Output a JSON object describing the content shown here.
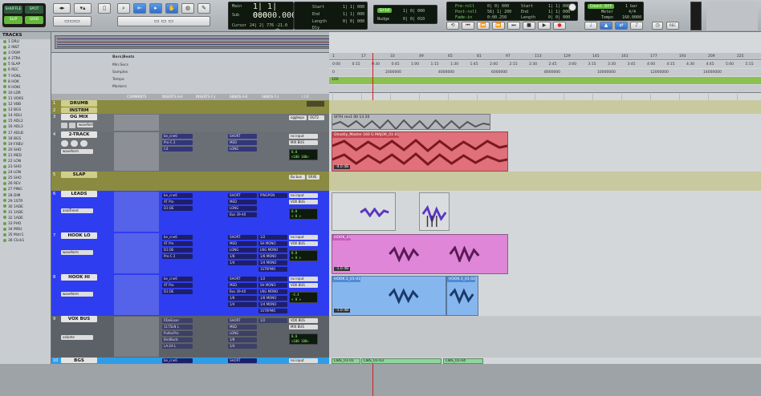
{
  "toolbar": {
    "modes": [
      "SHUFFLE",
      "SPOT",
      "SLIP",
      "GRID"
    ],
    "counter": {
      "main_label": "Main",
      "main_value": "1| 1| 000",
      "sub_label": "Sub",
      "sub_value": "0:000.000",
      "cursor_label": "Cursor",
      "cursor_value": "24| 2| 776",
      "db_value": "-21.0 db",
      "dly_label": "Dly"
    },
    "selection": {
      "start_label": "Start",
      "start_value": "1| 1| 000",
      "end_label": "End",
      "end_value": "1| 1| 000",
      "length_label": "Length",
      "length_value": "0| 0| 000"
    },
    "grid": {
      "label": "Grid",
      "value": "1| 0| 000",
      "nudge_label": "Nudge",
      "nudge_value": "0| 0| 010"
    },
    "preroll": {
      "pre_label": "Pre-roll",
      "pre_value": "0| 0| 000",
      "post_label": "Post-roll",
      "post_value": "56| 1| 200",
      "fade_label": "Fade-in",
      "fade_value": "0:00.250",
      "start_label": "Start",
      "start_value": "1| 1| 000",
      "end_label": "End",
      "end_value": "1| 1| 000",
      "length_label": "Length",
      "length_value": "0| 0| 000"
    },
    "meter": {
      "countoff": "Count Off",
      "bars": "1 bar",
      "meter_label": "Meter",
      "meter_value": "4/4",
      "tempo_label": "Tempo",
      "tempo_value": "160.0000"
    }
  },
  "tracks_panel": {
    "title": "TRACKS",
    "items": [
      "1 DRU",
      "2 INST",
      "3 OGM",
      "4 2TRA",
      "5 SLAP",
      "6 REC",
      "7 HOKL",
      "8 HOK",
      "9 HOKI",
      "10 LDR",
      "11 VOKS",
      "12 VBB",
      "13 BGS",
      "14 ADLI",
      "15 ADL2",
      "16 ADL3",
      "17 ADLB",
      "18 BGS",
      "19 FXBU",
      "20 SHD",
      "21 MED",
      "22 LON",
      "23 SHO",
      "24 LON",
      "25 SHO",
      "26 REV",
      "27 PING",
      "28 DIM",
      "29 1STR",
      "30 1ADE",
      "31 1ADE",
      "32 1ADE",
      "33 PHO",
      "34 MOU",
      "35 Mstr1",
      "36 Click1"
    ]
  },
  "rulers": {
    "bars_beats": "Bars|Beats",
    "min_secs": "Min:Secs",
    "samples": "Samples",
    "tempo": "Tempo",
    "markers": "Markers",
    "tempo_marker": "160",
    "bar_numbers": [
      "1",
      "17",
      "33",
      "49",
      "65",
      "81",
      "97",
      "113",
      "129",
      "145",
      "161",
      "177",
      "193",
      "209",
      "225"
    ],
    "min_secs_values": [
      "0:00",
      "0:15",
      "0:30",
      "0:45",
      "1:00",
      "1:15",
      "1:30",
      "1:45",
      "2:00",
      "2:15",
      "2:30",
      "2:45",
      "3:00",
      "3:15",
      "3:30",
      "3:45",
      "4:00",
      "4:15",
      "4:30",
      "4:45",
      "5:00",
      "5:15"
    ],
    "sample_values": [
      "0",
      "2000000",
      "4000000",
      "6000000",
      "8000000",
      "10000000",
      "12000000",
      "14000000"
    ]
  },
  "columns": {
    "comments": "COMMENTS",
    "inserts_ae": "INSERTS A-E",
    "inserts_fj": "INSERTS F-J",
    "sends_ae": "SENDS A-E",
    "sends_fj": "SENDS F-J",
    "io": "I / O"
  },
  "tracks": [
    {
      "num": "1",
      "name": "DRUMB"
    },
    {
      "num": "2",
      "name": "INSTRM"
    },
    {
      "num": "3",
      "name": "OG MIX",
      "io_in": "oggtwpv",
      "io_out": "OGT2",
      "waveform_label": "waveform",
      "clip": "SFFH rev1 00 13 20"
    },
    {
      "num": "4",
      "name": "2-TRACK",
      "plugins": [
        "be_cne6",
        "Pro-C 2",
        "C4"
      ],
      "sends": [
        "SHORT",
        "MED",
        "LONG"
      ],
      "io_in": "no input",
      "io_out": "MIX BUS",
      "vol": "0.0",
      "pan": "<100 100>",
      "waveform_label": "waveform",
      "clip": "Ghostly_Master 160 G MAJOR_01-01",
      "clip_gain": "-4.0 dB"
    },
    {
      "num": "5",
      "name": "SLAP",
      "io_in": "Bu bus",
      "io_out": "SRXE"
    },
    {
      "num": "6",
      "name": "LEADS",
      "plugins": [
        "be_cne6",
        "AT Pro",
        "D3 DE"
      ],
      "sends": [
        "SHORT",
        "MED",
        "LONG",
        "Bus 39-40"
      ],
      "sends_fj": [
        "PINGPON"
      ],
      "io_in": "no input",
      "io_out": "VOX BUS",
      "vol": "0.0",
      "pan": "< 0 >",
      "waveform_label": "analTrend"
    },
    {
      "num": "7",
      "name": "HOOK LO",
      "plugins": [
        "be_cne6",
        "AT Pro",
        "D3 DE",
        "Pro-C 2"
      ],
      "sends": [
        "SHORT",
        "MED",
        "LONG",
        "1/8",
        "1/4"
      ],
      "sends_fj": [
        "1/2",
        "SH MONO",
        "LNG MONO",
        "1/8 MONO",
        "1/4 MONO",
        "1STRPMO"
      ],
      "io_in": "no input",
      "io_out": "VOX BUS",
      "vol": "0.0",
      "pan": "< 0 >",
      "waveform_label": "waveform",
      "clip": "HOOK_01",
      "clip_gain": "-1.0 dB"
    },
    {
      "num": "8",
      "name": "HOOK HI",
      "plugins": [
        "be_cne6",
        "AT Pro",
        "D3 DE"
      ],
      "sends": [
        "SHORT",
        "MED",
        "Bus 39-40",
        "1/8",
        "1/4"
      ],
      "sends_fj": [
        "1/2",
        "SH MONO",
        "LNG MONO",
        "1/8 MONO",
        "1/4 MONO",
        "1STRPMO"
      ],
      "io_in": "no input",
      "io_out": "VOX BUS",
      "vol": "-4.4",
      "pan": "< 0 >",
      "waveform_label": "waveform",
      "clip": "HOOK 2_01-01",
      "clip2": "HOOK 2_01-02",
      "clip_gain": "-1.0 dB"
    },
    {
      "num": "9",
      "name": "VOX BUS",
      "plugins": [
        "RDeEsser",
        "1175LN L",
        "PultecPro",
        "BirdBuds",
        "LA-2A L"
      ],
      "sends": [
        "SHORT",
        "MED",
        "LONG",
        "1/8",
        "1/4"
      ],
      "sends_fj": [
        "1/2"
      ],
      "io_in": "VOX BUS",
      "io_out": "MIX BUS",
      "vol": "0.0",
      "pan": "<100 100>",
      "waveform_label": "volume"
    },
    {
      "num": "10",
      "name": "BGS",
      "plugins": [
        "be_cne6"
      ],
      "sends": [
        "SHORT"
      ],
      "io_in": "no input",
      "clip": "LIBS_01-01",
      "clip2": "LIBS_01-03",
      "clip3": "LIBS_01-04"
    }
  ],
  "colors": {
    "drum_track": "#8a8a40",
    "blue_track": "#2e3df0",
    "clip_red": "#e0707a",
    "clip_pink": "#df86d8",
    "clip_blue": "#86b6ee",
    "selected_green": "#64b83c"
  }
}
